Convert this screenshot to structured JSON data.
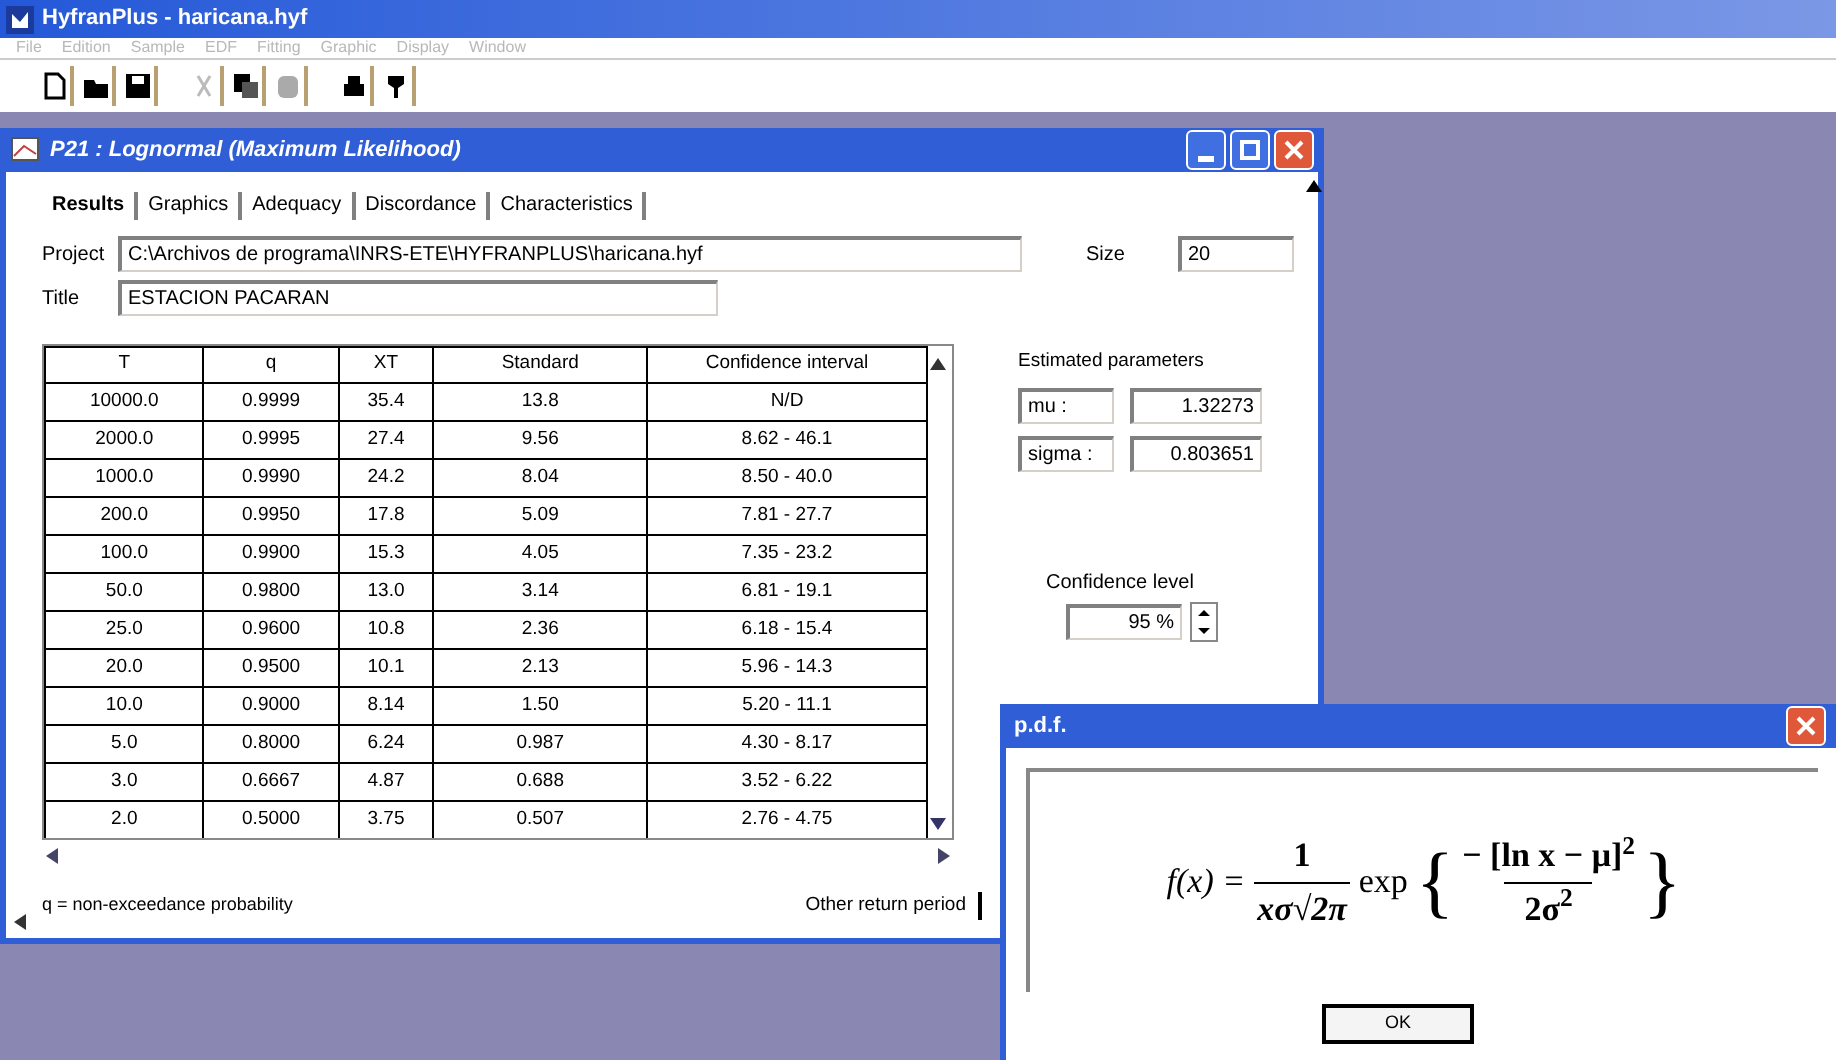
{
  "app_window": {
    "title": "HyfranPlus - haricana.hyf"
  },
  "menu": [
    "File",
    "Edition",
    "Sample",
    "EDF",
    "Fitting",
    "Graphic",
    "Display",
    "Window"
  ],
  "results_window": {
    "title": "P21 : Lognormal (Maximum Likelihood)"
  },
  "tabs": [
    {
      "label": "Results",
      "selected": true
    },
    {
      "label": "Graphics",
      "selected": false
    },
    {
      "label": "Adequacy",
      "selected": false
    },
    {
      "label": "Discordance",
      "selected": false
    },
    {
      "label": "Characteristics",
      "selected": false
    }
  ],
  "project": {
    "label": "Project",
    "value": "C:\\Archivos de programa\\INRS-ETE\\HYFRANPLUS\\haricana.hyf"
  },
  "size": {
    "label": "Size",
    "value": "20"
  },
  "title_field": {
    "label": "Title",
    "value": "ESTACION PACARAN"
  },
  "table": {
    "columns": [
      "T",
      "q",
      "XT",
      "Standard",
      "Confidence interval"
    ],
    "rows": [
      [
        "10000.0",
        "0.9999",
        "35.4",
        "13.8",
        "N/D"
      ],
      [
        "2000.0",
        "0.9995",
        "27.4",
        "9.56",
        "8.62 - 46.1"
      ],
      [
        "1000.0",
        "0.9990",
        "24.2",
        "8.04",
        "8.50 - 40.0"
      ],
      [
        "200.0",
        "0.9950",
        "17.8",
        "5.09",
        "7.81 - 27.7"
      ],
      [
        "100.0",
        "0.9900",
        "15.3",
        "4.05",
        "7.35 - 23.2"
      ],
      [
        "50.0",
        "0.9800",
        "13.0",
        "3.14",
        "6.81 - 19.1"
      ],
      [
        "25.0",
        "0.9600",
        "10.8",
        "2.36",
        "6.18 - 15.4"
      ],
      [
        "20.0",
        "0.9500",
        "10.1",
        "2.13",
        "5.96 - 14.3"
      ],
      [
        "10.0",
        "0.9000",
        "8.14",
        "1.50",
        "5.20 - 11.1"
      ],
      [
        "5.0",
        "0.8000",
        "6.24",
        "0.987",
        "4.30 - 8.17"
      ],
      [
        "3.0",
        "0.6667",
        "4.87",
        "0.688",
        "3.52 - 6.22"
      ],
      [
        "2.0",
        "0.5000",
        "3.75",
        "0.507",
        "2.76 - 4.75"
      ]
    ]
  },
  "parameters": {
    "title": "Estimated parameters",
    "items": [
      {
        "label": "mu :",
        "value": "1.32273"
      },
      {
        "label": "sigma :",
        "value": "0.803651"
      }
    ]
  },
  "confidence_level": {
    "label": "Confidence level",
    "value": "95 %"
  },
  "footnote": "q = non-exceedance probability",
  "other_return_period": "Other return period",
  "pdf_dialog": {
    "title": "p.d.f.",
    "formula": {
      "lhs": "f(x) =",
      "numerator": "1",
      "denominator": "xσ√2π",
      "function": "exp",
      "open_brace": "{",
      "inner_numerator": "− [ln x − μ]$^{2}$",
      "inner_denominator": "2σ$^{2}$",
      "close_brace": "}"
    },
    "button": "OK"
  }
}
